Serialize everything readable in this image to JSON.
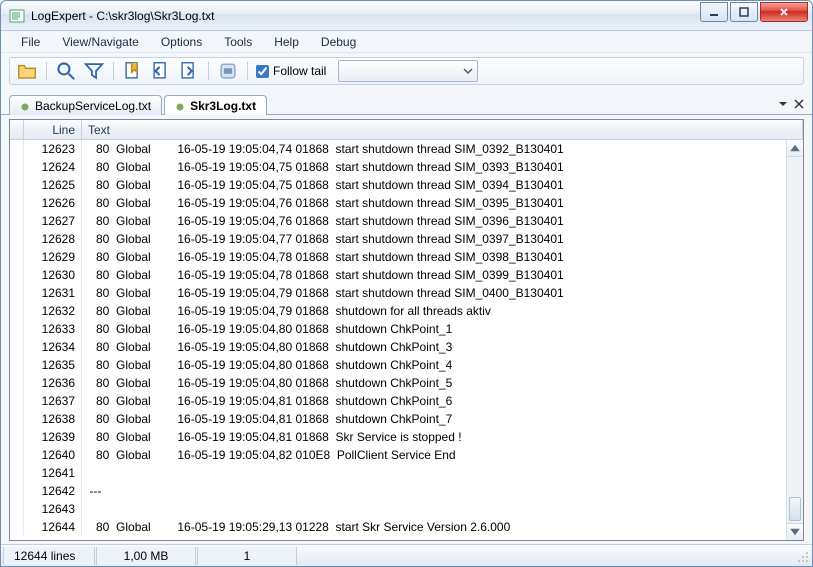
{
  "window": {
    "title": "LogExpert - C:\\skr3log\\Skr3Log.txt"
  },
  "menu": {
    "file": "File",
    "view": "View/Navigate",
    "options": "Options",
    "tools": "Tools",
    "help": "Help",
    "debug": "Debug"
  },
  "toolbar": {
    "follow_label": "Follow tail",
    "follow_checked": true
  },
  "tabs": [
    {
      "label": "BackupServiceLog.txt",
      "active": false
    },
    {
      "label": "Skr3Log.txt",
      "active": true
    }
  ],
  "columns": {
    "line": "Line",
    "text": "Text"
  },
  "rows": [
    {
      "line": "12623",
      "text": "   80  Global        16-05-19 19:05:04,74 01868  start shutdown thread SIM_0392_B130401"
    },
    {
      "line": "12624",
      "text": "   80  Global        16-05-19 19:05:04,75 01868  start shutdown thread SIM_0393_B130401"
    },
    {
      "line": "12625",
      "text": "   80  Global        16-05-19 19:05:04,75 01868  start shutdown thread SIM_0394_B130401"
    },
    {
      "line": "12626",
      "text": "   80  Global        16-05-19 19:05:04,76 01868  start shutdown thread SIM_0395_B130401"
    },
    {
      "line": "12627",
      "text": "   80  Global        16-05-19 19:05:04,76 01868  start shutdown thread SIM_0396_B130401"
    },
    {
      "line": "12628",
      "text": "   80  Global        16-05-19 19:05:04,77 01868  start shutdown thread SIM_0397_B130401"
    },
    {
      "line": "12629",
      "text": "   80  Global        16-05-19 19:05:04,78 01868  start shutdown thread SIM_0398_B130401"
    },
    {
      "line": "12630",
      "text": "   80  Global        16-05-19 19:05:04,78 01868  start shutdown thread SIM_0399_B130401"
    },
    {
      "line": "12631",
      "text": "   80  Global        16-05-19 19:05:04,79 01868  start shutdown thread SIM_0400_B130401"
    },
    {
      "line": "12632",
      "text": "   80  Global        16-05-19 19:05:04,79 01868  shutdown for all threads aktiv"
    },
    {
      "line": "12633",
      "text": "   80  Global        16-05-19 19:05:04,80 01868  shutdown ChkPoint_1"
    },
    {
      "line": "12634",
      "text": "   80  Global        16-05-19 19:05:04,80 01868  shutdown ChkPoint_3"
    },
    {
      "line": "12635",
      "text": "   80  Global        16-05-19 19:05:04,80 01868  shutdown ChkPoint_4"
    },
    {
      "line": "12636",
      "text": "   80  Global        16-05-19 19:05:04,80 01868  shutdown ChkPoint_5"
    },
    {
      "line": "12637",
      "text": "   80  Global        16-05-19 19:05:04,81 01868  shutdown ChkPoint_6"
    },
    {
      "line": "12638",
      "text": "   80  Global        16-05-19 19:05:04,81 01868  shutdown ChkPoint_7"
    },
    {
      "line": "12639",
      "text": "   80  Global        16-05-19 19:05:04,81 01868  Skr Service is stopped !"
    },
    {
      "line": "12640",
      "text": "   80  Global        16-05-19 19:05:04,82 010E8  PollClient Service End"
    },
    {
      "line": "12641",
      "text": ""
    },
    {
      "line": "12642",
      "text": " ---"
    },
    {
      "line": "12643",
      "text": ""
    },
    {
      "line": "12644",
      "text": "   80  Global        16-05-19 19:05:29,13 01228  start Skr Service Version 2.6.000"
    }
  ],
  "status": {
    "lines": "12644 lines",
    "size": "1,00 MB",
    "pos": "1"
  }
}
